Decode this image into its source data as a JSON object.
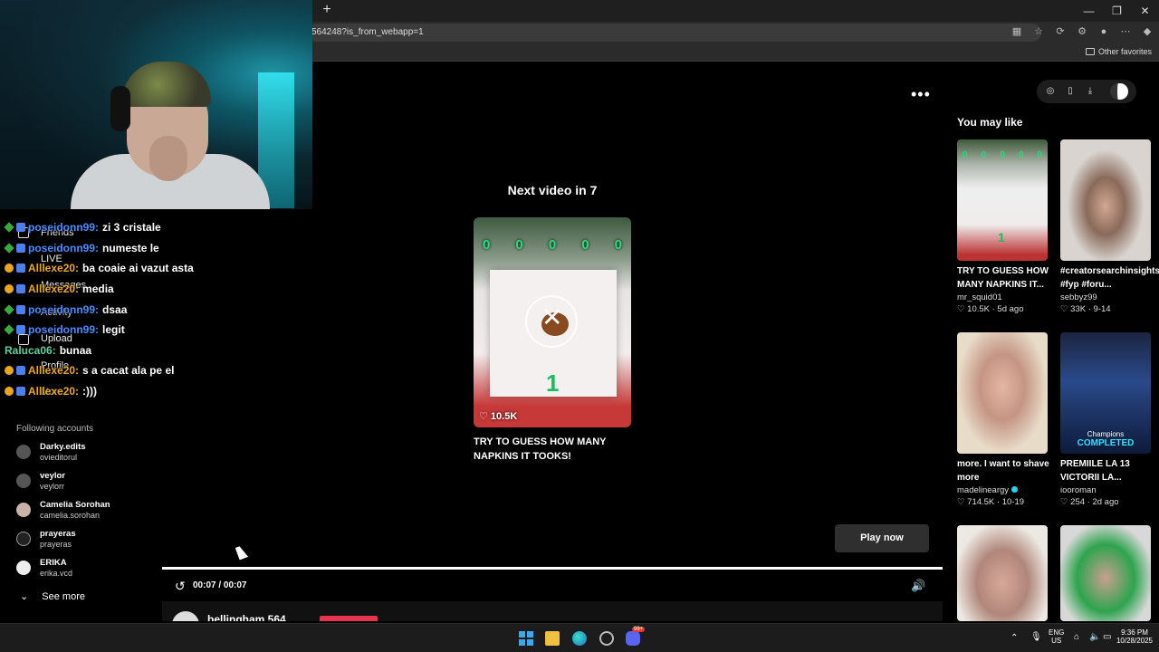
{
  "browser": {
    "url_fragment": "564248?is_from_webapp=1",
    "other_favorites": "Other favorites",
    "new_tab_glyph": "+",
    "win_controls": [
      "—",
      "❐",
      "✕"
    ]
  },
  "sidebar": {
    "nav": [
      {
        "label": "Friends",
        "icon": "friends-icon"
      },
      {
        "label": "LIVE",
        "icon": "live-icon"
      },
      {
        "label": "Messages",
        "icon": "messages-icon"
      },
      {
        "label": "Activity",
        "icon": "activity-icon"
      },
      {
        "label": "Upload",
        "icon": "upload-icon"
      },
      {
        "label": "Profile",
        "icon": "profile-icon"
      },
      {
        "label": "More",
        "icon": "more-icon"
      }
    ],
    "following_heading": "Following accounts",
    "accounts": [
      {
        "name": "Darky.edits",
        "handle": "ovieditorul"
      },
      {
        "name": "veylor",
        "handle": "veylorr"
      },
      {
        "name": "Camelia Sorohan",
        "handle": "camelia.sorohan"
      },
      {
        "name": "prayeras",
        "handle": "prayeras"
      },
      {
        "name": "ERIKA",
        "handle": "erika.vcd"
      }
    ],
    "see_more": "See more"
  },
  "chat": [
    {
      "user": "poseidonn99:",
      "msg": "zi 3 cristale",
      "color": "#4a8cff",
      "badges": [
        "mod",
        "sub"
      ]
    },
    {
      "user": "poseidonn99:",
      "msg": "numeste le",
      "color": "#4a8cff",
      "badges": [
        "mod",
        "sub"
      ]
    },
    {
      "user": "Alllexe20:",
      "msg": "ba coaie ai vazut asta",
      "color": "#e8a81e",
      "badges": [
        "gold",
        "sub"
      ]
    },
    {
      "user": "Alllexe20:",
      "msg": "media",
      "color": "#e8a81e",
      "badges": [
        "gold",
        "sub"
      ]
    },
    {
      "user": "poseidonn99:",
      "msg": "dsaa",
      "color": "#4a8cff",
      "badges": [
        "mod",
        "sub"
      ]
    },
    {
      "user": "poseidonn99:",
      "msg": "legit",
      "color": "#4a8cff",
      "badges": [
        "mod",
        "sub"
      ]
    },
    {
      "user": "Raluca06:",
      "msg": "bunaa",
      "color": "#5fd0a0",
      "badges": []
    },
    {
      "user": "Alllexe20:",
      "msg": "s a cacat ala pe el",
      "color": "#e8a81e",
      "badges": [
        "gold",
        "sub"
      ]
    },
    {
      "user": "Alllexe20:",
      "msg": ":)))",
      "color": "#e8a81e",
      "badges": [
        "gold",
        "sub"
      ]
    }
  ],
  "player": {
    "next_title": "Next video in 7",
    "next_scores": [
      "0",
      "0",
      "0",
      "0",
      "0"
    ],
    "next_counter": "1",
    "next_likes": "♡ 10.5K",
    "next_caption": "TRY TO GUESS HOW MANY NAPKINS IT TOOKS!",
    "play_now": "Play now",
    "timecode": "00:07 / 00:07",
    "progress": 1.0,
    "more_glyph": "•••",
    "replay_glyph": "↺",
    "volume_glyph": "🔊",
    "author_name": "bellingham.564"
  },
  "rail": {
    "title": "You may like",
    "cards": [
      {
        "title": "TRY TO GUESS HOW MANY NAPKINS IT...",
        "author": "mr_squid01",
        "meta": "♡ 10.5K · 5d ago",
        "verified": false
      },
      {
        "title": "#creatorsearchinsights #fyp #foru...",
        "author": "sebbyz99",
        "meta": "♡ 33K · 9-14",
        "verified": false
      },
      {
        "title": "more. I want to shave more",
        "author": "madelineargy",
        "meta": "♡ 714.5K · 10-19",
        "verified": true
      },
      {
        "title": "PREMIILE LA 13 VICTORII LA...",
        "author": "iooroman",
        "meta": "♡ 254 · 2d ago",
        "verified": false,
        "overlay1": "Champions",
        "overlay2": "COMPLETED"
      },
      {
        "title": "",
        "author": "",
        "meta": "",
        "verified": false
      },
      {
        "title": "",
        "author": "",
        "meta": "",
        "verified": false
      }
    ]
  },
  "taskbar": {
    "lang": "ENG",
    "region": "US",
    "time": "9:36 PM",
    "date": "10/28/2025",
    "discord_badge": "99+"
  }
}
